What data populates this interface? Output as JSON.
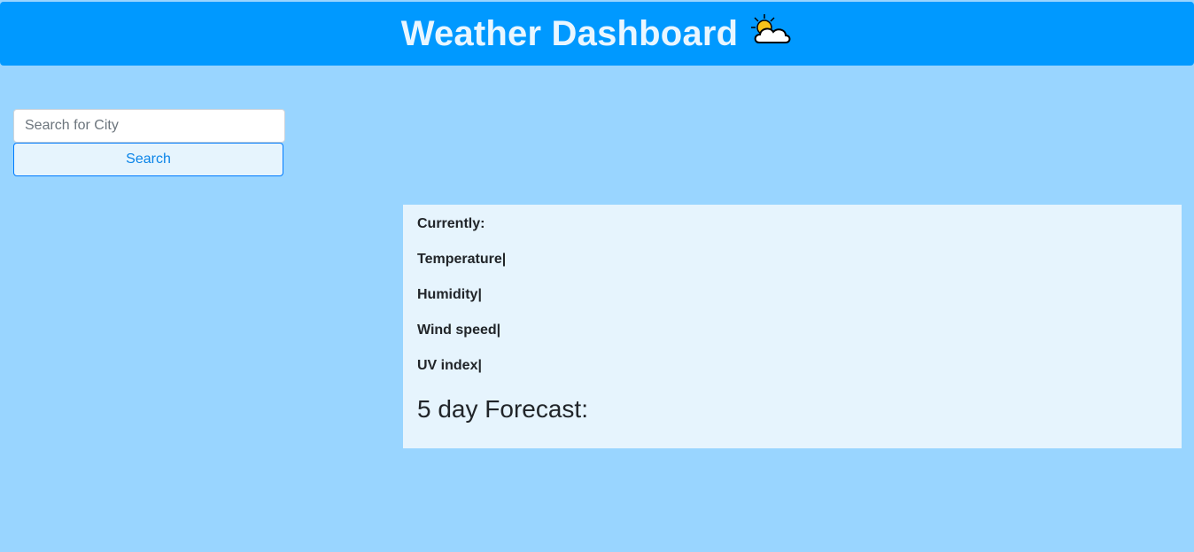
{
  "header": {
    "title": "Weather Dashboard",
    "icon": "sun-behind-cloud-icon"
  },
  "search": {
    "placeholder": "Search for City",
    "value": "",
    "button_label": "Search"
  },
  "current": {
    "currently_label": "Currently:",
    "temperature_label": "Temperature|",
    "humidity_label": "Humidity|",
    "wind_label": "Wind speed|",
    "uv_label": "UV index|",
    "forecast_title": "5 day Forecast:"
  },
  "colors": {
    "page_bg": "#99d5ff",
    "header_bg": "#0099ff",
    "panel_bg": "#e6f4fd",
    "button_border": "#007bff"
  }
}
